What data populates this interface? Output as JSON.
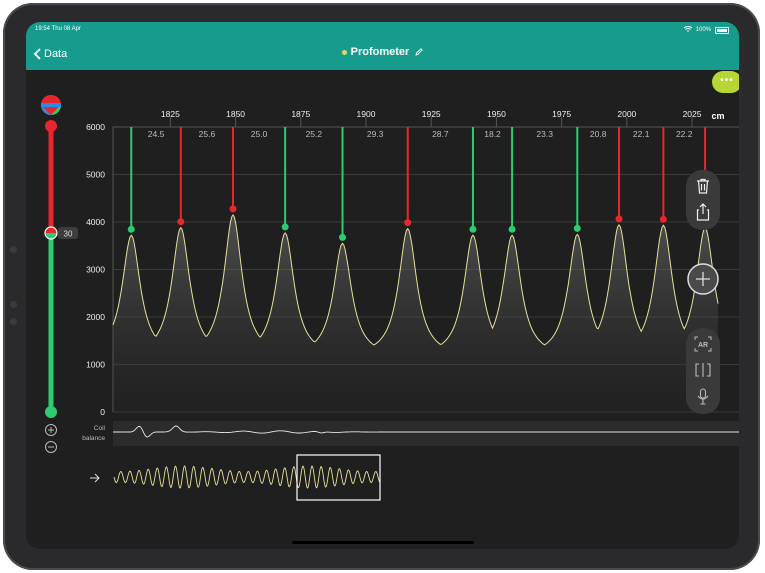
{
  "status_bar": {
    "time": "19:54 Thu 08 Apr",
    "battery": "100%"
  },
  "nav": {
    "back_label": "Data",
    "title": "Profometer"
  },
  "toolbar": {
    "more_label": "•••"
  },
  "slider": {
    "value_label": "30",
    "value": 30,
    "range": [
      0,
      100
    ]
  },
  "axis": {
    "x_unit": "cm",
    "x_ticks": [
      "1825",
      "1850",
      "1875",
      "1900",
      "1925",
      "1950",
      "1975",
      "2000",
      "2025"
    ],
    "y_ticks": [
      "6000",
      "5000",
      "4000",
      "3000",
      "2000",
      "1000",
      "0"
    ]
  },
  "coil": {
    "label_line1": "Coil",
    "label_line2": "balance"
  },
  "chart_data": {
    "type": "line",
    "x_unit": "cm",
    "xlim": [
      1803,
      2043
    ],
    "ylim": [
      0,
      6000
    ],
    "x_ticks": [
      1825,
      1850,
      1875,
      1900,
      1925,
      1950,
      1975,
      2000,
      2025
    ],
    "y_ticks": [
      0,
      1000,
      2000,
      3000,
      4000,
      5000,
      6000
    ],
    "grid": true,
    "peaks": [
      {
        "x": 1810,
        "y": 3720,
        "status": "green"
      },
      {
        "x": 1829,
        "y": 3880,
        "status": "red"
      },
      {
        "x": 1849,
        "y": 4150,
        "status": "red"
      },
      {
        "x": 1869,
        "y": 3770,
        "status": "green"
      },
      {
        "x": 1891,
        "y": 3550,
        "status": "green"
      },
      {
        "x": 1916,
        "y": 3860,
        "status": "red"
      },
      {
        "x": 1941,
        "y": 3720,
        "status": "green"
      },
      {
        "x": 1956,
        "y": 3720,
        "status": "green"
      },
      {
        "x": 1981,
        "y": 3740,
        "status": "green"
      },
      {
        "x": 1997,
        "y": 3940,
        "status": "red"
      },
      {
        "x": 2014,
        "y": 3930,
        "status": "red"
      },
      {
        "x": 2030,
        "y": 3880,
        "status": "red"
      }
    ],
    "spacings": [
      "24.5",
      "25.6",
      "25.0",
      "25.2",
      "29.3",
      "28.7",
      "18.2",
      "23.3",
      "20.8",
      "22.1",
      "22.2"
    ]
  },
  "colors": {
    "header": "#169b8c",
    "accent_green": "#2ecc71",
    "accent_red": "#e8262e",
    "signal": "#e6e09a",
    "more": "#b6d634"
  },
  "icons": {
    "color_wheel": "color-wheel-icon",
    "trash": "trash-icon",
    "share": "share-icon",
    "add": "plus-circle-icon",
    "ar": "ar-icon",
    "compare": "compare-icon",
    "mic": "mic-icon",
    "zoom_in": "zoom-in-icon",
    "zoom_out": "zoom-out-icon",
    "arrow": "arrow-right-icon"
  }
}
